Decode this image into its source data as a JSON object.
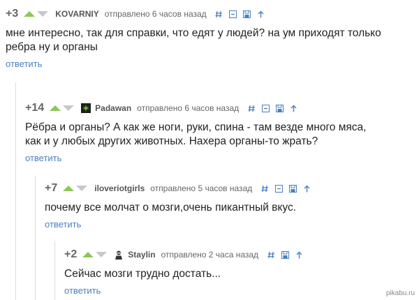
{
  "comments": [
    {
      "rating": "+3",
      "author": "KOVARNIY",
      "posted": "отправлено 6 часов назад",
      "text": "мне интересно, так для справки, что едят у людей? на ум приходят только ребра ну и органы",
      "reply": "ответить"
    },
    {
      "rating": "+14",
      "author": "Padawan",
      "posted": "отправлено 6 часов назад",
      "text": "Рёбра и органы? А как же ноги, руки, спина - там везде много мяса, как и у любых других животных. Нахера органы-то жрать?",
      "reply": "ответить"
    },
    {
      "rating": "+7",
      "author": "iloveriotgirls",
      "posted": "отправлено 5 часов назад",
      "text": "почему все молчат о мозги,очень пикантный вкус.",
      "reply": "ответить"
    },
    {
      "rating": "+2",
      "author": "Staylin",
      "posted": "отправлено 2 часа назад",
      "text": "Сейчас мозги трудно достать...",
      "reply": "ответить"
    }
  ],
  "watermark": "pikabu.ru",
  "colors": {
    "vote_up": "#8ac858",
    "vote_down": "#c8c8c8",
    "link": "#4a7fc1",
    "thread_line": "#dcdcdc"
  },
  "icons": [
    "hash-link-icon",
    "collapse-icon",
    "save-icon",
    "parent-arrow-icon"
  ]
}
